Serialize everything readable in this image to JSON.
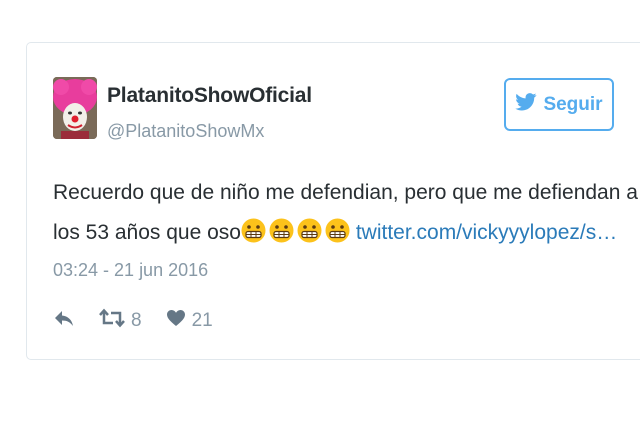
{
  "user": {
    "display_name": "PlatanitoShowOficial",
    "handle": "@PlatanitoShowMx"
  },
  "follow_button": {
    "label": "Seguir",
    "icon": "twitter-bird-icon",
    "color": "#55acee"
  },
  "tweet": {
    "text_line": "Recuerdo que de niño me defendian, pero que me defiendan a los 53 años que oso",
    "emoji_count": 4,
    "emoji": "grimacing-face-icon",
    "link": "twitter.com/vickyyylopez/s…"
  },
  "timestamp": "03:24 - 21 jun 2016",
  "actions": {
    "reply_icon": "reply-icon",
    "retweet_icon": "retweet-icon",
    "retweet_count": "8",
    "like_icon": "heart-icon",
    "like_count": "21"
  },
  "colors": {
    "text": "#292f33",
    "muted": "#8899a6",
    "link": "#2b7bb9",
    "border": "#e1e8ed"
  }
}
